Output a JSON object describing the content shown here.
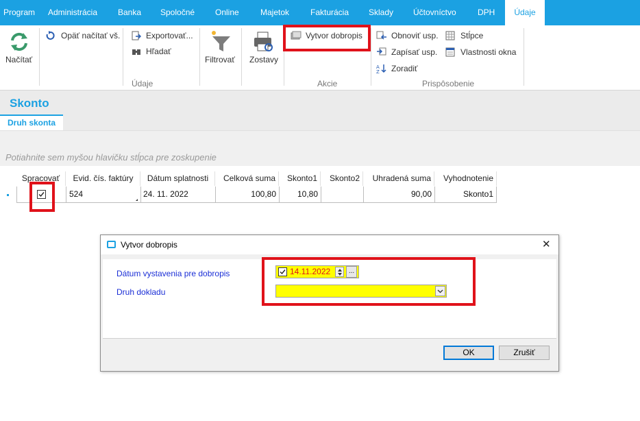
{
  "menu": {
    "items": [
      "Program",
      "Administrácia",
      "Banka",
      "Spoločné",
      "Online",
      "Majetok",
      "Fakturácia",
      "Sklady",
      "Účtovníctvo",
      "DPH",
      "Údaje"
    ],
    "active": "Údaje"
  },
  "ribbon": {
    "nacitat": "Načítať",
    "opat_nacitat": "Opäť načítať vš.",
    "exportovat": "Exportovať...",
    "hladat": "Hľadať",
    "filtrovat": "Filtrovať",
    "zostavy": "Zostavy",
    "vytvor_dobropis": "Vytvor dobropis",
    "obnovit_usp": "Obnoviť usp.",
    "zapisat_usp": "Zapísať usp.",
    "zoradit": "Zoradiť",
    "stlpce": "Stĺpce",
    "vlastnosti_okna": "Vlastnosti okna",
    "groups": {
      "udaje": "Údaje",
      "akcie": "Akcie",
      "prisposobenie": "Prispôsobenie"
    }
  },
  "page": {
    "title": "Skonto",
    "tab": "Druh skonta",
    "group_hint": "Potiahnite sem myšou hlavičku stĺpca pre zoskupenie"
  },
  "grid": {
    "columns": [
      "Spracovať",
      "Evid. čís. faktúry",
      "Dátum splatnosti",
      "Celková suma",
      "Skonto1",
      "Skonto2",
      "Uhradená suma",
      "Vyhodnotenie"
    ],
    "rows": [
      {
        "spracovat": true,
        "evid": "524",
        "datum": "24. 11. 2022",
        "celkova": "100,80",
        "skonto1": "10,80",
        "skonto2": "",
        "uhradena": "90,00",
        "vyhodnotenie": "Skonto1"
      }
    ]
  },
  "dialog": {
    "title": "Vytvor dobropis",
    "label_datum": "Dátum vystavenia pre dobropis",
    "label_druh": "Druh dokladu",
    "date_value": "14.11.2022",
    "date_checked": true,
    "druh_value": "",
    "ok": "OK",
    "cancel": "Zrušiť",
    "browse": "...",
    "close": "✕"
  },
  "colors": {
    "accent": "#1ba1e2",
    "highlight": "#e0121a",
    "field": "#ffff00"
  }
}
